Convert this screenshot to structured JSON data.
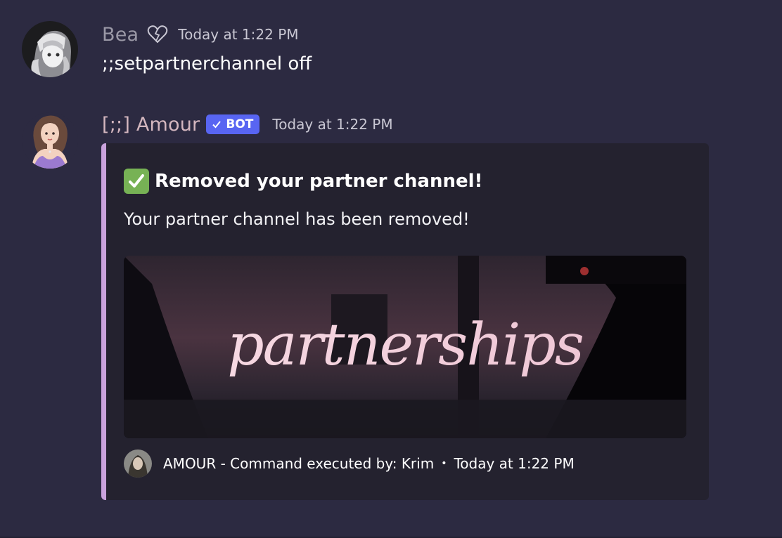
{
  "messages": [
    {
      "author": "Bea",
      "author_color": "#9a98a6",
      "badge_icon": "broken-heart-icon",
      "timestamp": "Today at 1:22 PM",
      "content": ";;setpartnerchannel off"
    },
    {
      "author": "[;;] Amour",
      "author_color": "#d4b7bf",
      "bot_tag": "BOT",
      "bot_tag_color": "#5865f2",
      "timestamp": "Today at 1:22 PM",
      "embed": {
        "accent_color": "#c9a2dc",
        "title_icon": "check-mark-icon",
        "title": "Removed your partner channel!",
        "description": "Your partner channel has been removed!",
        "image_text": "partnerships",
        "footer_text": "AMOUR - Command executed by: Krim",
        "footer_separator": "•",
        "footer_timestamp": "Today at 1:22 PM"
      }
    }
  ]
}
